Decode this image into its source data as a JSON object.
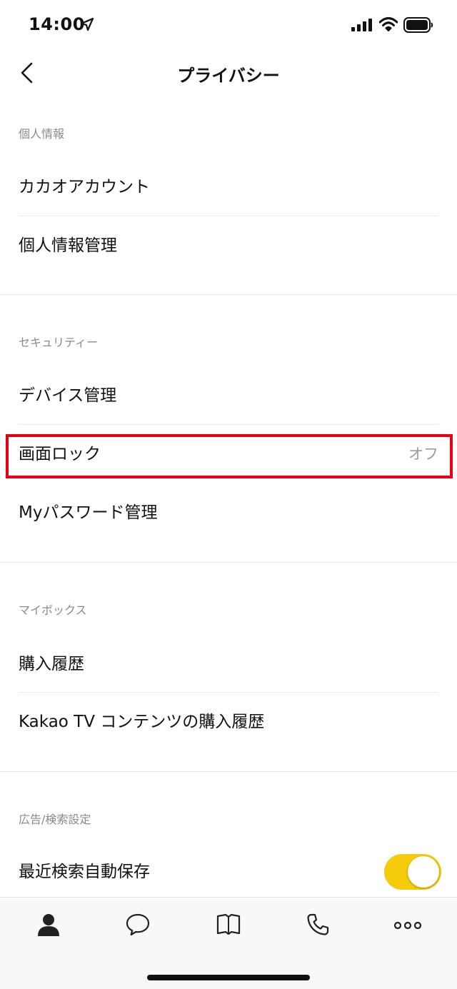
{
  "status_bar": {
    "time": "14:00",
    "icons": [
      "location-arrow-icon",
      "cellular-signal-icon",
      "wifi-icon",
      "battery-icon"
    ]
  },
  "nav": {
    "title": "プライバシー",
    "back_icon": "chevron-left-icon"
  },
  "sections": [
    {
      "header": "個人情報",
      "items": [
        {
          "label": "カカオアカウント"
        },
        {
          "label": "個人情報管理"
        }
      ]
    },
    {
      "header": "セキュリティー",
      "items": [
        {
          "label": "デバイス管理"
        },
        {
          "label": "画面ロック",
          "value": "オフ",
          "highlighted": true
        },
        {
          "label": "Myパスワード管理"
        }
      ]
    },
    {
      "header": "マイボックス",
      "items": [
        {
          "label": "購入履歴"
        },
        {
          "label": "Kakao TV コンテンツの購入履歴"
        }
      ]
    },
    {
      "header": "広告/検索設定",
      "items": [
        {
          "label": "最近検索自動保存",
          "toggle": true,
          "toggle_on": true
        }
      ]
    }
  ],
  "tab_bar": {
    "tabs": [
      {
        "icon": "person-icon",
        "active": true
      },
      {
        "icon": "chat-bubble-icon",
        "active": false
      },
      {
        "icon": "open-book-icon",
        "active": false
      },
      {
        "icon": "phone-icon",
        "active": false
      },
      {
        "icon": "more-dots-icon",
        "active": false
      }
    ]
  },
  "colors": {
    "toggle_on": "#f5cb0c",
    "highlight_border": "#e60012",
    "section_header": "#8a8a8a",
    "value_text": "#9a9a9a"
  }
}
